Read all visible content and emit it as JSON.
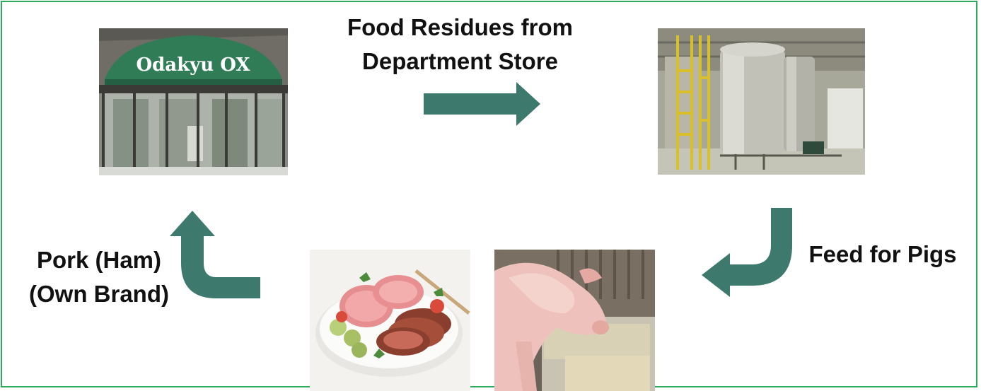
{
  "colors": {
    "border": "#2eaa5c",
    "arrow": "#3d7a6d"
  },
  "labels": {
    "food_residues_line1": "Food Residues from",
    "food_residues_line2": "Department Store",
    "feed_for_pigs": "Feed for Pigs",
    "pork_line1": "Pork (Ham)",
    "pork_line2": "(Own Brand)"
  },
  "photos": {
    "store": {
      "sign_text": "Odakyu OX"
    },
    "plant": {},
    "pig": {},
    "ham": {}
  },
  "icons": [
    "arrow-right-icon",
    "arrow-curved-down-left-icon",
    "arrow-curved-up-icon"
  ]
}
